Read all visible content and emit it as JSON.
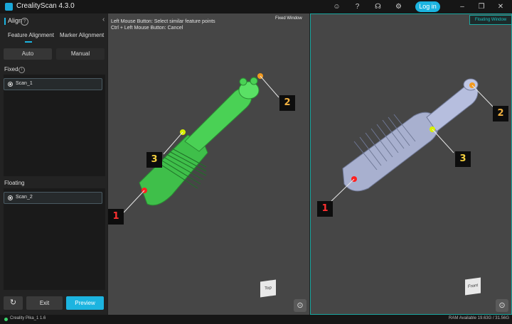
{
  "app": {
    "title": "CrealityScan 4.3.0",
    "login_label": "Log in"
  },
  "align": {
    "title": "Align",
    "tabs": [
      "Feature Alignment",
      "Marker Alignment"
    ],
    "modes": [
      "Auto",
      "Manual"
    ],
    "fixed_label": "Fixed",
    "floating_label": "Floating",
    "fixed_scan": "Scan_1",
    "floating_scan": "Scan_2"
  },
  "buttons": {
    "exit": "Exit",
    "preview": "Preview"
  },
  "instructions": {
    "line1": "Left Mouse Button: Select similar feature points",
    "line2": "Ctrl + Left Mouse Button: Cancel"
  },
  "fixed_window": {
    "tag": "Fixed Window",
    "view_cube": "Top",
    "points": [
      {
        "id": "1",
        "color": "#ff2020"
      },
      {
        "id": "2",
        "color": "#f39a1f"
      },
      {
        "id": "3",
        "color": "#d8f000"
      }
    ]
  },
  "floating_window": {
    "tag": "Floating Window",
    "view_cube": "Front",
    "points": [
      {
        "id": "1",
        "color": "#ff2020"
      },
      {
        "id": "2",
        "color": "#f39a1f"
      },
      {
        "id": "3",
        "color": "#d8f000"
      }
    ]
  },
  "status": {
    "device": "Creality Pika_1 1.6",
    "ram": "RAM Available 19.63G / 31.56G"
  },
  "colors": {
    "accent": "#1cb4e0",
    "fixed_model": "#3fbf4a",
    "floating_model": "#a8b0cf"
  }
}
